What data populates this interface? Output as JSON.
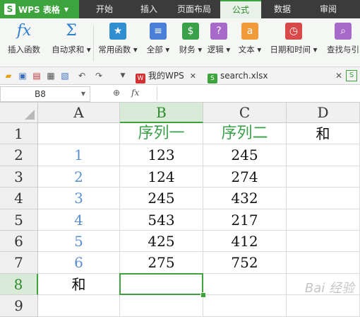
{
  "app": {
    "name": "WPS 表格",
    "logo_letter": "S"
  },
  "menu_tabs": [
    "开始",
    "插入",
    "页面布局",
    "公式",
    "数据",
    "审阅"
  ],
  "active_menu_tab": "公式",
  "ribbon": [
    {
      "label": "插入函数",
      "icon": "fx-icon",
      "glyph": "fx",
      "color": "#2f7fd1"
    },
    {
      "label": "自动求和 ▾",
      "icon": "sigma-icon",
      "glyph": "Σ",
      "color": "#2f7fd1"
    },
    {
      "label": "常用函数 ▾",
      "icon": "star-icon",
      "glyph": "★",
      "color": "#2f8fd1"
    },
    {
      "label": "全部 ▾",
      "icon": "list-icon",
      "glyph": "≡",
      "color": "#4a7fd8"
    },
    {
      "label": "财务 ▾",
      "icon": "finance-icon",
      "glyph": "$",
      "color": "#3aa04a"
    },
    {
      "label": "逻辑 ▾",
      "icon": "logic-icon",
      "glyph": "?",
      "color": "#a86ac8"
    },
    {
      "label": "文本 ▾",
      "icon": "text-icon",
      "glyph": "a",
      "color": "#f09a3a"
    },
    {
      "label": "日期和时间 ▾",
      "icon": "clock-icon",
      "glyph": "◷",
      "color": "#d84a4a"
    },
    {
      "label": "查找与引",
      "icon": "lookup-icon",
      "glyph": "⌕",
      "color": "#a86ac8"
    }
  ],
  "doc_tabs": [
    {
      "label": "我的WPS",
      "icon": "wps-icon",
      "glyph": "W",
      "color": "#d03030"
    },
    {
      "label": "search.xlsx",
      "icon": "sheet-icon",
      "glyph": "S",
      "color": "#3da33d"
    }
  ],
  "name_box": "B8",
  "fx_label": "fx",
  "columns": [
    "A",
    "B",
    "C",
    "D"
  ],
  "selected_column": "B",
  "selected_row": "8",
  "rows": [
    {
      "num": "1",
      "cells": [
        "",
        "序列一",
        "序列二",
        "和"
      ]
    },
    {
      "num": "2",
      "cells": [
        "1",
        "123",
        "245",
        ""
      ]
    },
    {
      "num": "3",
      "cells": [
        "2",
        "124",
        "274",
        ""
      ]
    },
    {
      "num": "4",
      "cells": [
        "3",
        "245",
        "432",
        ""
      ]
    },
    {
      "num": "5",
      "cells": [
        "4",
        "543",
        "217",
        ""
      ]
    },
    {
      "num": "6",
      "cells": [
        "5",
        "425",
        "412",
        ""
      ]
    },
    {
      "num": "7",
      "cells": [
        "6",
        "275",
        "752",
        ""
      ]
    },
    {
      "num": "8",
      "cells": [
        "和",
        "",
        "",
        ""
      ]
    },
    {
      "num": "9",
      "cells": [
        "",
        "",
        "",
        ""
      ]
    }
  ],
  "watermark": "Bai 经验"
}
